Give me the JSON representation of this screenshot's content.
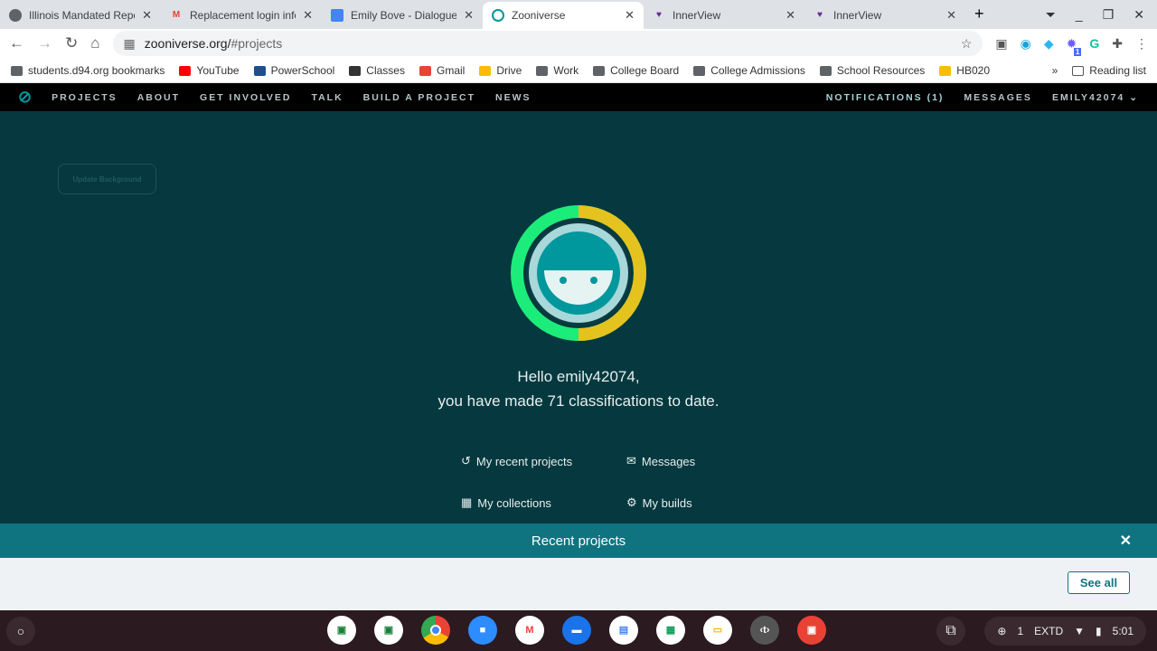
{
  "browser": {
    "tabs": [
      {
        "title": "Illinois Mandated Repor",
        "icon": "globe-icon",
        "active": false
      },
      {
        "title": "Replacement login info",
        "icon": "gmail-icon",
        "active": false
      },
      {
        "title": "Emily Bove - Dialogue P",
        "icon": "docs-icon",
        "active": false
      },
      {
        "title": "Zooniverse",
        "icon": "zooniverse-icon",
        "active": true
      },
      {
        "title": "InnerView",
        "icon": "innerview-icon",
        "active": false
      },
      {
        "title": "InnerView",
        "icon": "innerview-icon",
        "active": false
      }
    ],
    "url_host": "zooniverse.org/",
    "url_path": "#projects",
    "ext_badge": "1",
    "bookmarks": [
      "students.d94.org bookmarks",
      "YouTube",
      "PowerSchool",
      "Classes",
      "Gmail",
      "Drive",
      "Work",
      "College Board",
      "College Admissions",
      "School Resources",
      "HB020"
    ],
    "overflow": "»",
    "reading_list": "Reading list"
  },
  "site_nav": {
    "items": [
      "PROJECTS",
      "ABOUT",
      "GET INVOLVED",
      "TALK",
      "BUILD A PROJECT",
      "NEWS"
    ],
    "notifications": "NOTIFICATIONS (1)",
    "messages": "MESSAGES",
    "user": "EMILY42074"
  },
  "main": {
    "update_background": "Update Background",
    "hello": "Hello emily42074,",
    "classifications": "you have made 71 classifications to date.",
    "links": {
      "recent": "My recent projects",
      "messages": "Messages",
      "collections": "My collections",
      "builds": "My builds"
    },
    "recent_projects": "Recent projects",
    "see_all": "See all"
  },
  "colors": {
    "ring_green": "#1ced7a",
    "ring_yellow": "#e4c31e",
    "teal": "#0f7480",
    "bg": "#05393f"
  },
  "taskbar": {
    "tray_count": "1",
    "mode": "EXTD",
    "time": "5:01"
  }
}
